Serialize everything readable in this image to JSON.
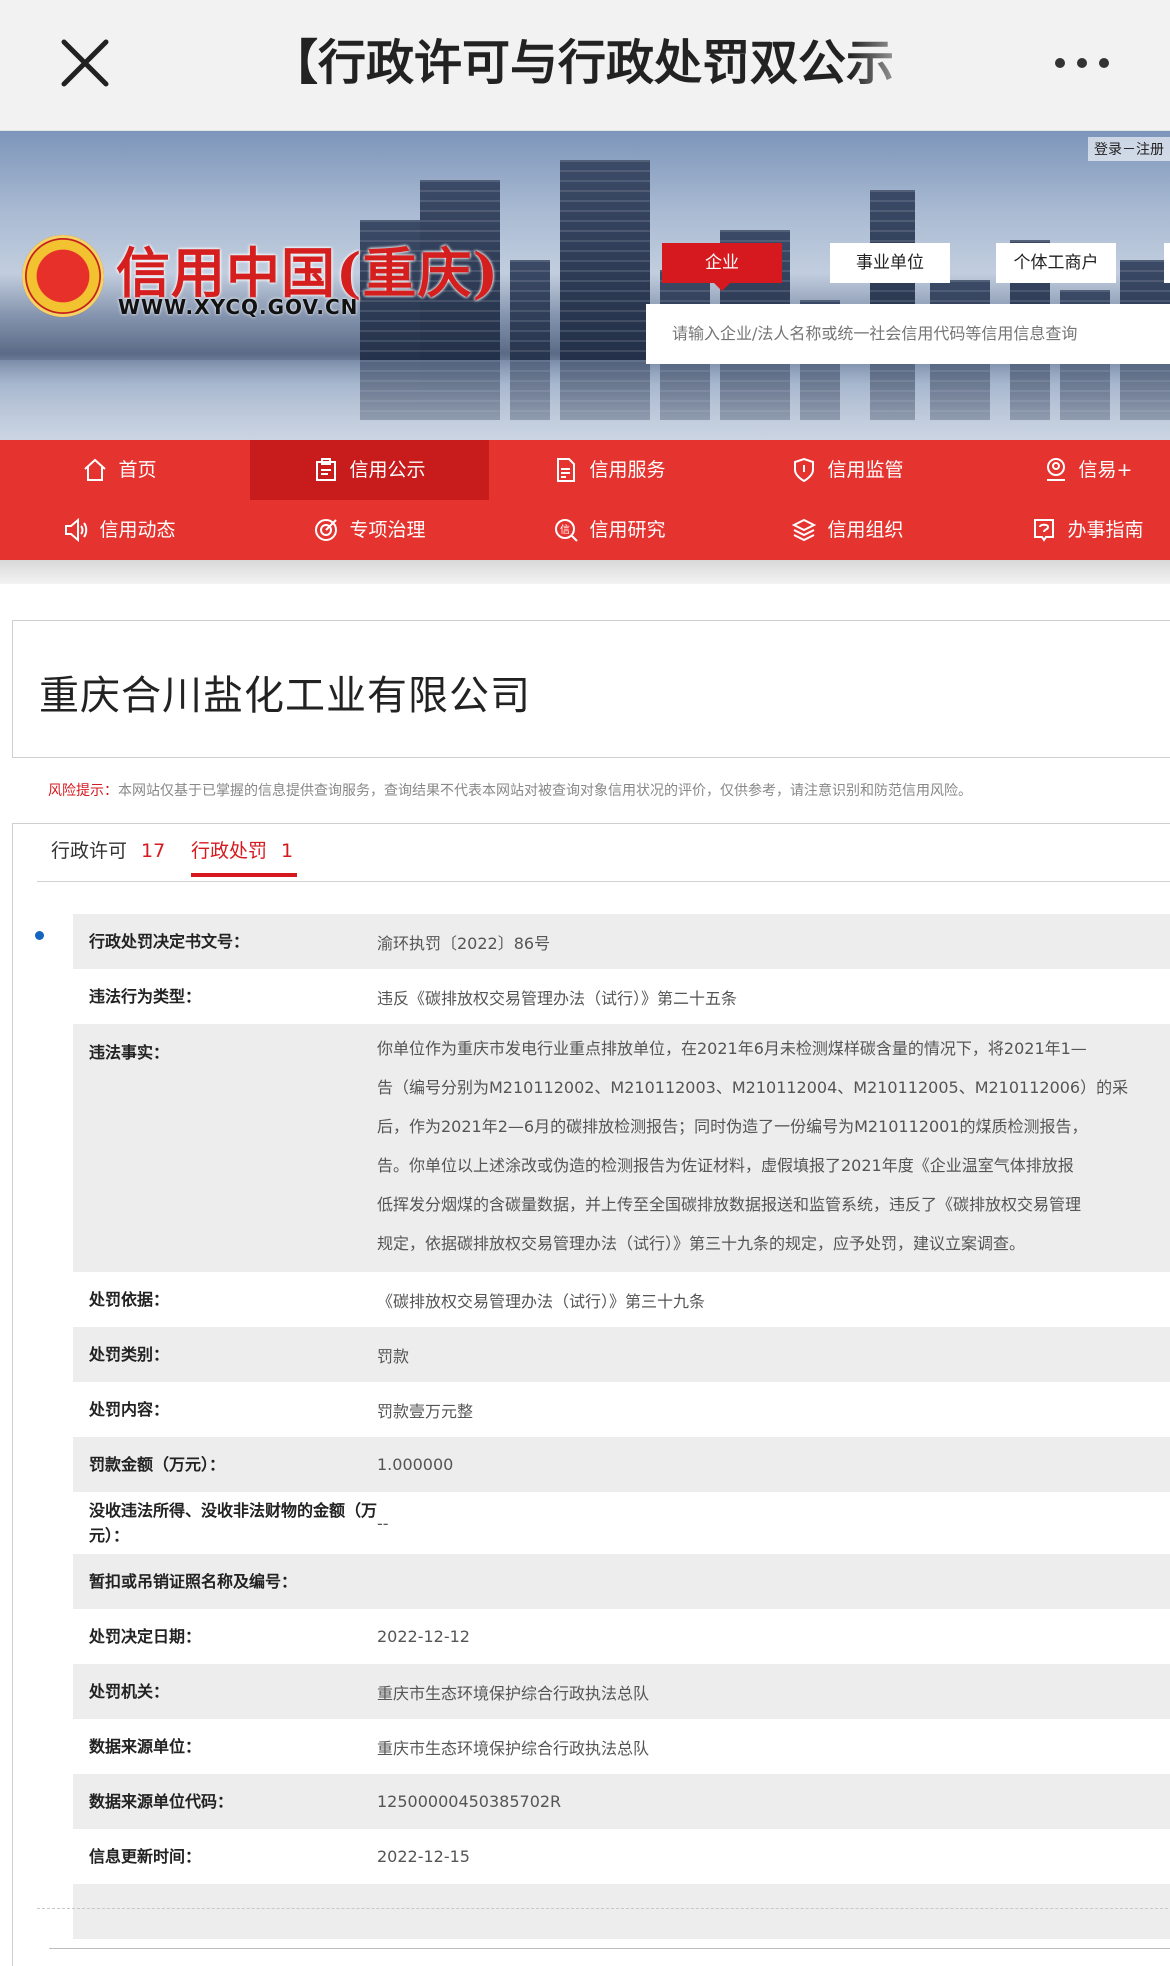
{
  "topbar": {
    "title": "【行政许可与行政处罚双公示"
  },
  "header": {
    "login": "登录－注册",
    "logo_text": "信用中国(重庆)",
    "logo_url": "WWW.XYCQ.GOV.CN",
    "type_tabs": [
      "企业",
      "事业单位",
      "个体工商户"
    ],
    "search_placeholder": "请输入企业/法人名称或统一社会信用代码等信用信息查询"
  },
  "nav": {
    "items": [
      {
        "label": "首页",
        "icon": "home-icon"
      },
      {
        "label": "信用公示",
        "icon": "clipboard-icon"
      },
      {
        "label": "信用服务",
        "icon": "document-icon"
      },
      {
        "label": "信用监管",
        "icon": "shield-icon"
      },
      {
        "label": "信易+",
        "icon": "user-badge-icon"
      },
      {
        "label": "信用动态",
        "icon": "speaker-icon"
      },
      {
        "label": "专项治理",
        "icon": "target-icon"
      },
      {
        "label": "信用研究",
        "icon": "search-credit-icon"
      },
      {
        "label": "信用组织",
        "icon": "layers-icon"
      },
      {
        "label": "办事指南",
        "icon": "guide-icon"
      }
    ]
  },
  "company": {
    "name": "重庆合川盐化工业有限公司"
  },
  "risk": {
    "label": "风险提示：",
    "text": "本网站仅基于已掌握的信息提供查询服务，查询结果不代表本网站对被查询对象信用状况的评价，仅供参考，请注意识别和防范信用风险。"
  },
  "tabs": [
    {
      "label": "行政许可",
      "count": "17"
    },
    {
      "label": "行政处罚",
      "count": "1"
    }
  ],
  "record": {
    "rows": [
      {
        "label": "行政处罚决定书文号：",
        "value": "渝环执罚〔2022〕86号"
      },
      {
        "label": "违法行为类型：",
        "value": "违反《碳排放权交易管理办法（试行）》第二十五条"
      },
      {
        "label": "违法事实：",
        "lines": [
          "你单位作为重庆市发电行业重点排放单位，在2021年6月未检测煤样碳含量的情况下，将2021年1—",
          "告（编号分别为M210112002、M210112003、M210112004、M210112005、M210112006）的采",
          "后，作为2021年2—6月的碳排放检测报告；同时伪造了一份编号为M210112001的煤质检测报告，",
          "告。你单位以上述涂改或伪造的检测报告为佐证材料，虚假填报了2021年度《企业温室气体排放报",
          "低挥发分烟煤的含碳量数据，并上传至全国碳排放数据报送和监管系统，违反了《碳排放权交易管理",
          "规定，依据碳排放权交易管理办法（试行）》第三十九条的规定，应予处罚，建议立案调查。"
        ]
      },
      {
        "label": "处罚依据：",
        "value": "《碳排放权交易管理办法（试行）》第三十九条"
      },
      {
        "label": "处罚类别：",
        "value": "罚款"
      },
      {
        "label": "处罚内容：",
        "value": "罚款壹万元整"
      },
      {
        "label": "罚款金额（万元）：",
        "value": "1.000000"
      },
      {
        "label": "没收违法所得、没收非法财物的金额（万元）：",
        "value": "--"
      },
      {
        "label": "暂扣或吊销证照名称及编号：",
        "value": ""
      },
      {
        "label": "处罚决定日期：",
        "value": "2022-12-12"
      },
      {
        "label": "处罚机关：",
        "value": "重庆市生态环境保护综合行政执法总队"
      },
      {
        "label": "数据来源单位：",
        "value": "重庆市生态环境保护综合行政执法总队"
      },
      {
        "label": "数据来源单位代码：",
        "value": "12500000450385702R"
      },
      {
        "label": "信息更新时间：",
        "value": "2022-12-15"
      }
    ]
  }
}
